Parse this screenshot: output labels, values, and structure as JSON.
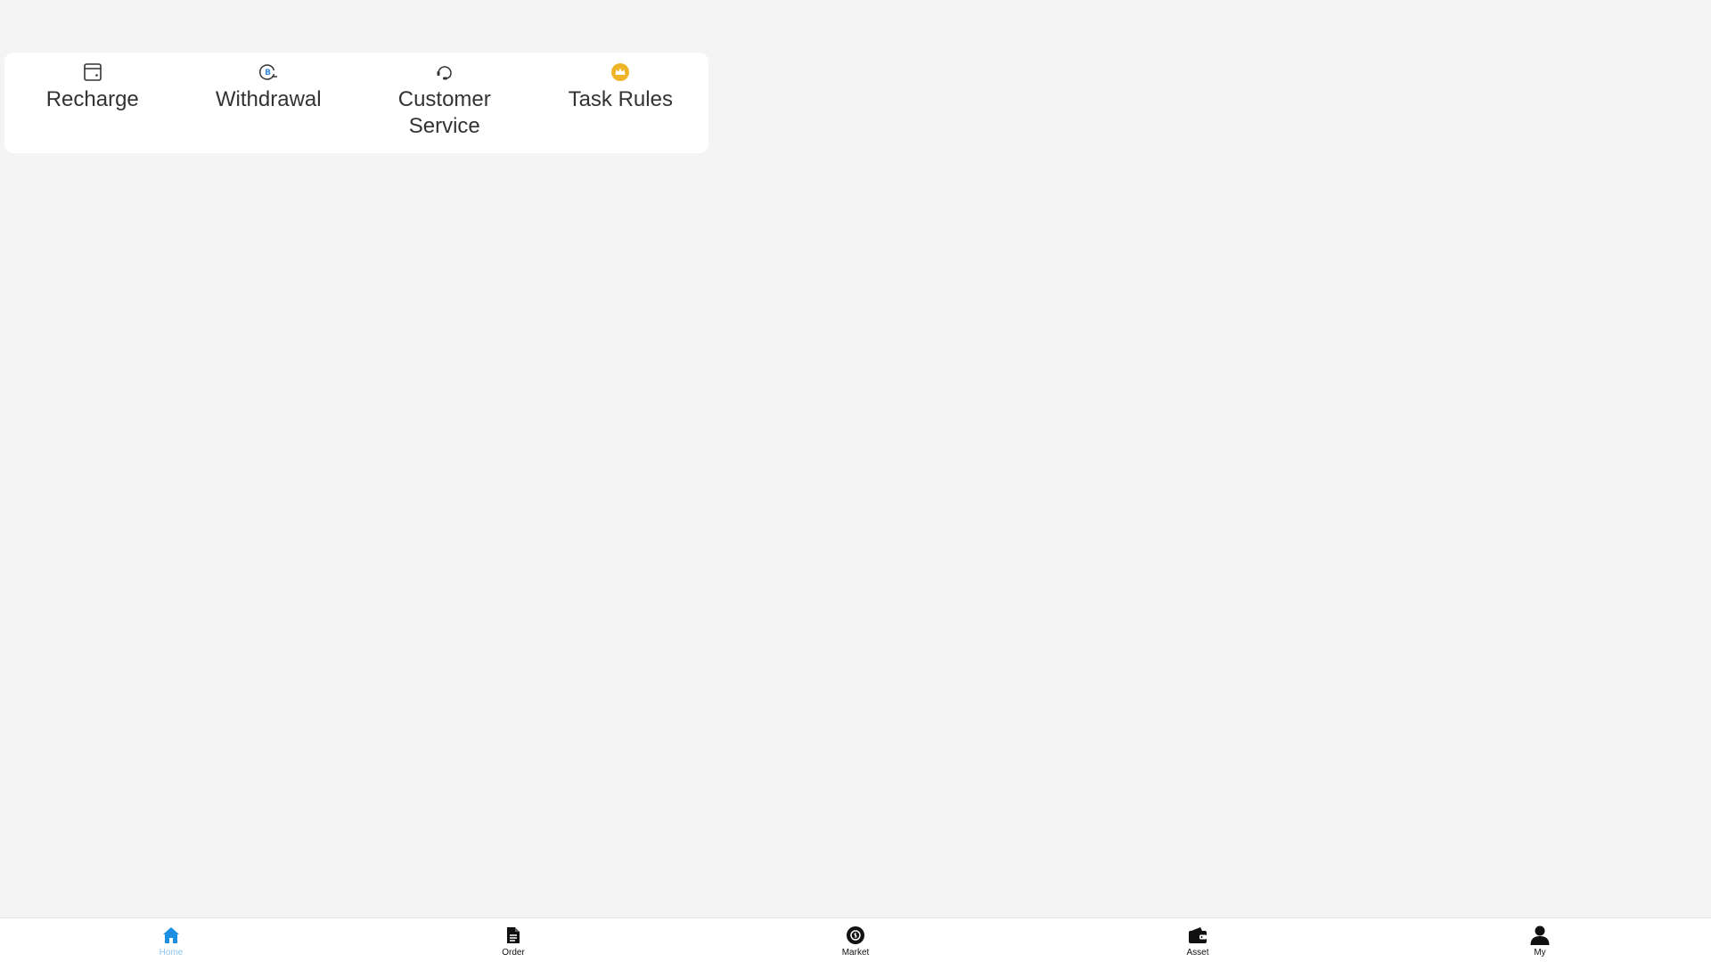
{
  "quick_actions": {
    "items": [
      {
        "label": "Recharge",
        "icon": "wallet-card-icon"
      },
      {
        "label": "Withdrawal",
        "icon": "bitcoin-withdraw-icon"
      },
      {
        "label": "Customer Service",
        "icon": "headset-icon"
      },
      {
        "label": "Task Rules",
        "icon": "crown-icon"
      }
    ]
  },
  "bottom_nav": {
    "active_index": 0,
    "items": [
      {
        "label": "Home",
        "icon": "home-icon"
      },
      {
        "label": "Order",
        "icon": "document-icon"
      },
      {
        "label": "Market",
        "icon": "market-icon"
      },
      {
        "label": "Asset",
        "icon": "wallet-icon"
      },
      {
        "label": "My",
        "icon": "user-icon"
      }
    ]
  },
  "colors": {
    "page_background": "#f4f4f4",
    "card_background": "#ffffff",
    "active_nav": "#1a8fe3",
    "active_nav_label": "#8cc4ea",
    "crown": "#f0b429",
    "bitcoin": "#3a8ee6"
  }
}
